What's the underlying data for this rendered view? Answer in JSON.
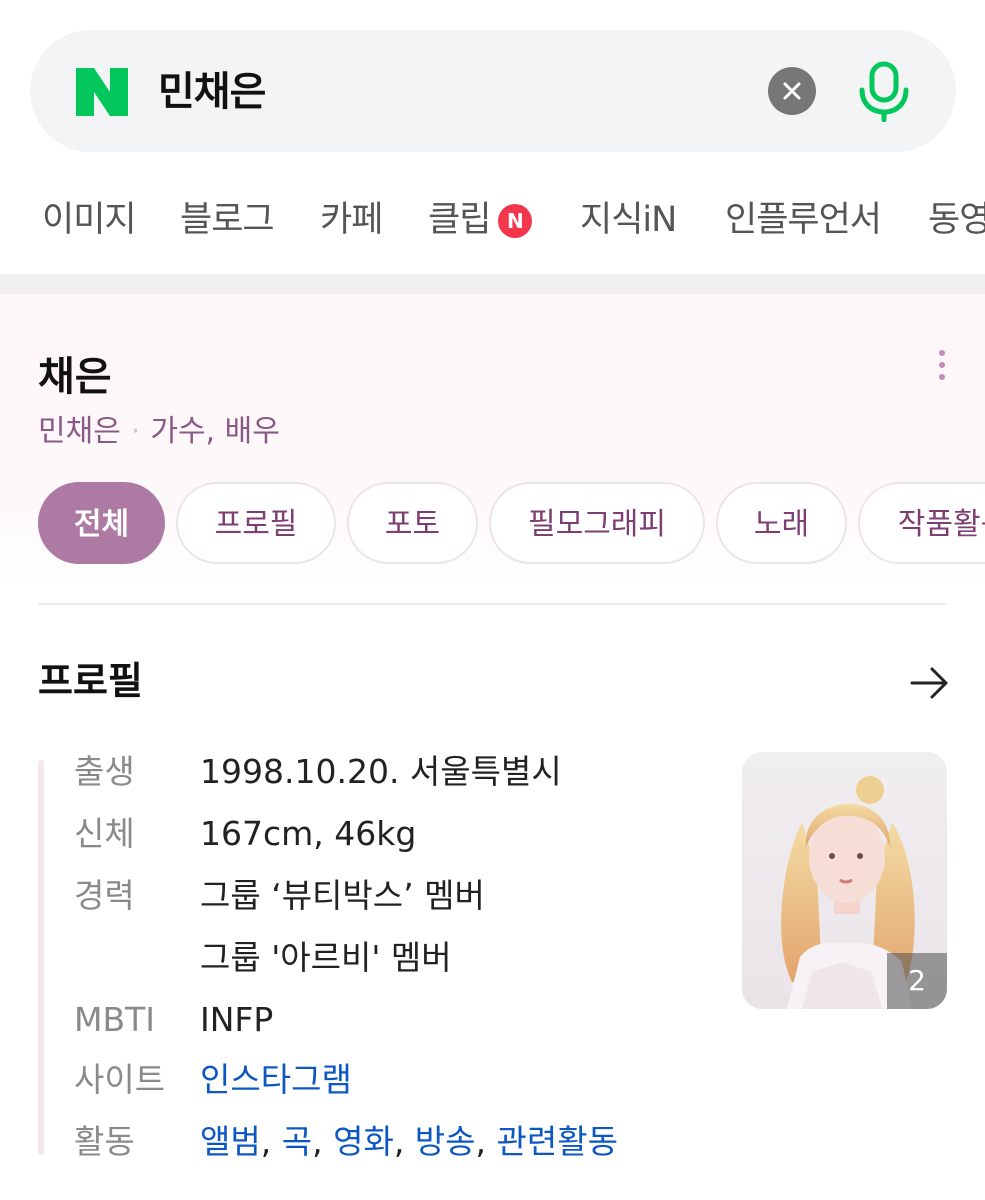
{
  "search": {
    "logo_letter": "N",
    "query": "민채은"
  },
  "tabs": [
    {
      "label": "이미지"
    },
    {
      "label": "블로그"
    },
    {
      "label": "카페"
    },
    {
      "label": "클립",
      "badge": "N"
    },
    {
      "label": "지식iN"
    },
    {
      "label": "인플루언서"
    },
    {
      "label": "동영상"
    }
  ],
  "entity": {
    "title": "채은",
    "subtitle_name": "민채은",
    "subtitle_role": "가수, 배우",
    "chips": [
      {
        "label": "전체",
        "active": true
      },
      {
        "label": "프로필"
      },
      {
        "label": "포토"
      },
      {
        "label": "필모그래피"
      },
      {
        "label": "노래"
      },
      {
        "label": "작품활동"
      }
    ]
  },
  "profile": {
    "title": "프로필",
    "rows": [
      {
        "label": "출생",
        "value": "1998.10.20. 서울특별시"
      },
      {
        "label": "신체",
        "value": "167cm, 46kg"
      },
      {
        "label": "경력",
        "value": "그룹 ‘뷰티박스’ 멤버"
      },
      {
        "label": "",
        "value": "그룹 '아르비' 멤버"
      },
      {
        "label": "MBTI",
        "value": "INFP"
      },
      {
        "label": "사이트",
        "value": "인스타그램"
      }
    ],
    "activity": {
      "label": "활동",
      "links": [
        "앨범",
        "곡",
        "영화",
        "방송",
        "관련활동"
      ]
    },
    "photo_count": "2"
  },
  "colors": {
    "naver_green": "#03c75a",
    "accent_purple": "#ad7aa4",
    "link_blue": "#0d57c3",
    "badge_red": "#f4364c"
  }
}
